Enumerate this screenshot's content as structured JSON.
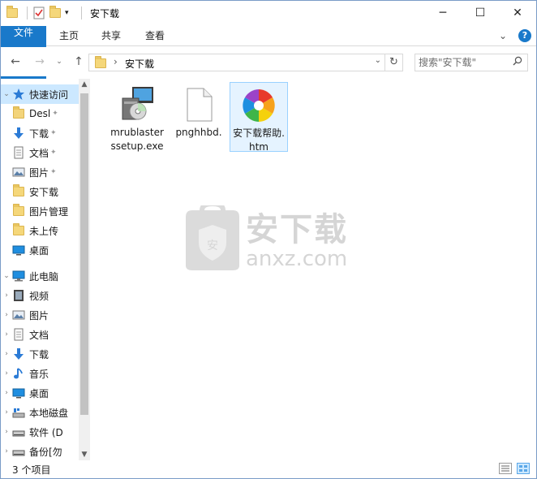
{
  "window": {
    "title": "安下载"
  },
  "title_controls": {
    "minimize": "─",
    "maximize": "☐",
    "close": "✕"
  },
  "ribbon": {
    "tabs": [
      {
        "label": "文件",
        "active": true
      },
      {
        "label": "主页"
      },
      {
        "label": "共享"
      },
      {
        "label": "查看"
      }
    ],
    "collapse_glyph": "⌄",
    "help_glyph": "?"
  },
  "nav": {
    "back_glyph": "←",
    "forward_glyph": "→",
    "recent_glyph": "⌄",
    "up_glyph": "↑",
    "breadcrumb": "安下载",
    "address_dropdown_glyph": "⌄",
    "refresh_glyph": "↻",
    "search_placeholder": "搜索\"安下载\"",
    "search_glyph": "🔍"
  },
  "navpane": {
    "quick_access_label": "快速访问",
    "quick_items": [
      {
        "label": "Desl",
        "icon": "folder-icon",
        "pinned": true
      },
      {
        "label": "下载",
        "icon": "download-icon",
        "pinned": true
      },
      {
        "label": "文档",
        "icon": "document-icon",
        "pinned": true
      },
      {
        "label": "图片",
        "icon": "picture-icon",
        "pinned": true
      },
      {
        "label": "安下载",
        "icon": "folder-icon"
      },
      {
        "label": "图片管理",
        "icon": "folder-icon"
      },
      {
        "label": "未上传",
        "icon": "folder-icon"
      },
      {
        "label": "桌面",
        "icon": "desktop-icon"
      }
    ],
    "pc_label": "此电脑",
    "pc_items": [
      {
        "label": "视频",
        "icon": "video-icon"
      },
      {
        "label": "图片",
        "icon": "picture-icon"
      },
      {
        "label": "文档",
        "icon": "document-icon"
      },
      {
        "label": "下载",
        "icon": "download-icon"
      },
      {
        "label": "音乐",
        "icon": "music-icon"
      },
      {
        "label": "桌面",
        "icon": "desktop-icon"
      },
      {
        "label": "本地磁盘",
        "icon": "disk-icon"
      },
      {
        "label": "软件 (D",
        "icon": "drive-icon"
      },
      {
        "label": "备份[勿",
        "icon": "drive-icon"
      }
    ],
    "pin_glyph": "📌"
  },
  "files": [
    {
      "name": "mrublasterssetup.exe",
      "display": "mrublasterssetup.exe",
      "icon": "installer-icon",
      "selected": false
    },
    {
      "name": "pnghhbd.",
      "display": "pnghhbd.",
      "icon": "blank-file-icon",
      "selected": false
    },
    {
      "name": "安下载帮助.htm",
      "display": "安下载帮助.htm",
      "icon": "browser-pinwheel-icon",
      "selected": true
    }
  ],
  "watermark": {
    "text_cn": "安下载",
    "text_en": "anxz.com"
  },
  "status": {
    "count": "3 个项目"
  },
  "colors": {
    "accent": "#1979ca",
    "selection": "#cce8ff",
    "folder": "#f5d77a"
  }
}
